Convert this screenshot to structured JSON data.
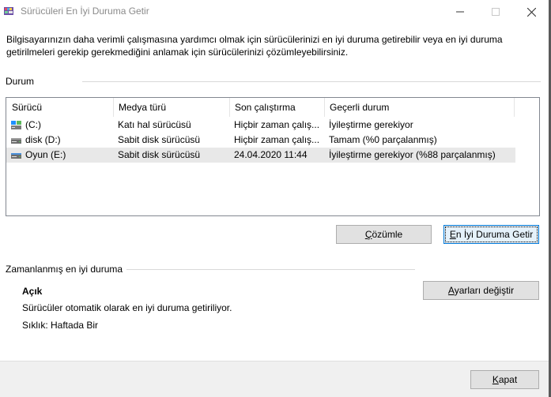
{
  "window": {
    "title": "Sürücüleri En İyi Duruma Getir"
  },
  "description": "Bilgisayarınızın daha verimli çalışmasına yardımcı olmak için sürücülerinizi en iyi duruma getirebilir veya en iyi duruma getirilmeleri gerekip gerekmediğini anlamak için sürücülerinizi çözümleyebilirsiniz.",
  "status_section": {
    "label": "Durum",
    "columns": [
      "Sürücü",
      "Medya türü",
      "Son çalıştırma",
      "Geçerli durum"
    ],
    "rows": [
      {
        "drive": "(C:)",
        "icon": "ssd-drive-icon",
        "media": "Katı hal sürücüsü",
        "last_run": "Hiçbir zaman çalış...",
        "status": "İyileştirme gerekiyor",
        "selected": false
      },
      {
        "drive": "disk (D:)",
        "icon": "hdd-drive-icon",
        "media": "Sabit disk sürücüsü",
        "last_run": "Hiçbir zaman çalış...",
        "status": "Tamam (%0 parçalanmış)",
        "selected": false
      },
      {
        "drive": "Oyun (E:)",
        "icon": "hdd-drive-icon",
        "media": "Sabit disk sürücüsü",
        "last_run": "24.04.2020 11:44",
        "status": "İyileştirme gerekiyor (%88 parçalanmış)",
        "selected": true
      }
    ]
  },
  "buttons": {
    "analyze": {
      "accel": "Ç",
      "rest": "özümle"
    },
    "optimize": {
      "accel": "E",
      "rest": "n İyi Duruma Getir"
    },
    "change_settings": {
      "accel": "A",
      "rest": "yarları değiştir"
    },
    "close": {
      "accel": "K",
      "rest": "apat"
    }
  },
  "scheduled_section": {
    "label": "Zamanlanmış en iyi duruma",
    "state": "Açık",
    "info": "Sürücüler otomatik olarak en iyi duruma getiriliyor.",
    "frequency": "Sıklık: Haftada Bir"
  },
  "colors": {
    "accent": "#0078d7",
    "selection": "#e8e8e8",
    "button_face": "#e1e1e1"
  }
}
